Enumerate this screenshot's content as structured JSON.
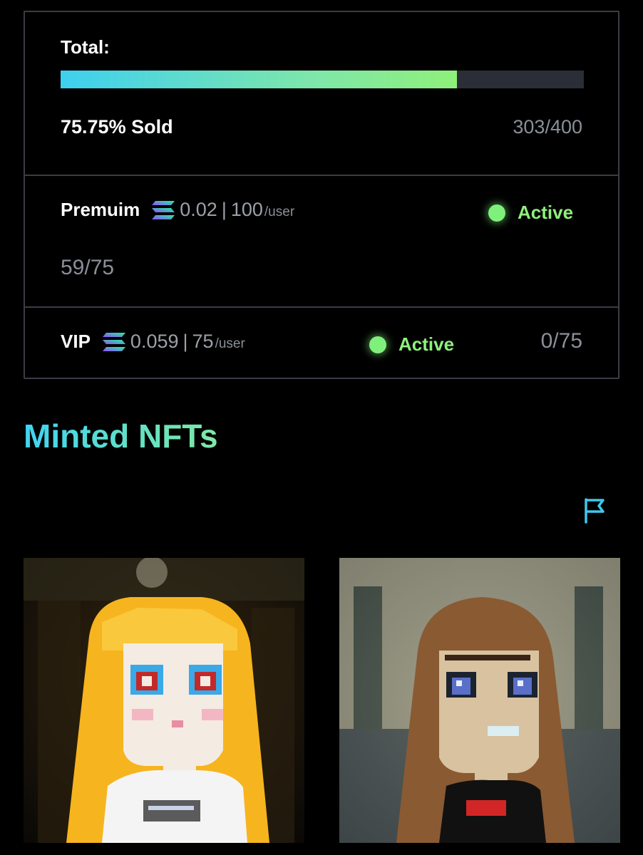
{
  "mint": {
    "total_label": "Total:",
    "sold_fraction": 0.7575,
    "sold_text": "75.75% Sold",
    "count_text": "303/400"
  },
  "tiers": [
    {
      "name": "Premuim",
      "icon": "solana-icon",
      "price": "0.02",
      "separator": "|",
      "limit": "100",
      "per": "/user",
      "status": "Active",
      "count": "59/75"
    },
    {
      "name": "VIP",
      "icon": "solana-icon",
      "price": "0.059",
      "separator": "|",
      "limit": "75",
      "per": "/user",
      "status": "Active",
      "count": "0/75"
    }
  ],
  "minted": {
    "title": "Minted NFTs",
    "flag_icon": "flag-icon",
    "items": [
      {
        "name": "nft-card",
        "style": "blonde-pixel-girl"
      },
      {
        "name": "nft-card",
        "style": "brunette-pixel-girl"
      }
    ]
  },
  "colors": {
    "accent_cyan": "#3fd4f2",
    "accent_green": "#8ef07d",
    "panel_border": "#3a3d46",
    "muted": "#8b8f98"
  }
}
